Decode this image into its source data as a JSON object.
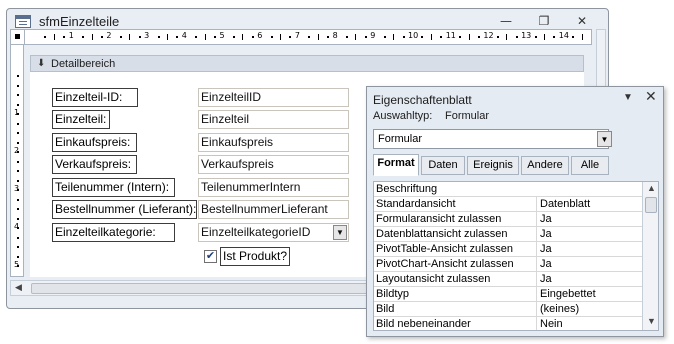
{
  "window": {
    "title": "sfmEinzelteile",
    "minimize_glyph": "—",
    "restore_glyph": "❐",
    "close_glyph": "✕"
  },
  "ruler": {
    "h_numbers": [
      "1",
      "2",
      "3",
      "4",
      "5",
      "6",
      "7",
      "8",
      "9",
      "10",
      "11",
      "12",
      "13",
      "14"
    ],
    "v_numbers": [
      "1",
      "2",
      "3",
      "4",
      "5"
    ]
  },
  "section": {
    "label": "Detailbereich",
    "icon": "collapse-arrow-icon"
  },
  "form": {
    "rows": [
      {
        "label": "Einzelteil-ID:",
        "field": "EinzelteilID"
      },
      {
        "label": "Einzelteil:",
        "field": "Einzelteil"
      },
      {
        "label": "Einkaufspreis:",
        "field": "Einkaufspreis"
      },
      {
        "label": "Verkaufspreis:",
        "field": "Verkaufspreis"
      },
      {
        "label": "Teilenummer (Intern):",
        "field": "TeilenummerIntern"
      },
      {
        "label": "Bestellnummer (Lieferant):",
        "field": "BestellnummerLieferant"
      },
      {
        "label": "Einzelteilkategorie:",
        "field": "EinzelteilkategorieID"
      }
    ],
    "checkbox_label": "Ist Produkt?",
    "checkbox_checked": true
  },
  "property_sheet": {
    "title": "Eigenschaftenblatt",
    "selection_label": "Auswahltyp:",
    "selection_value": "Formular",
    "object_select": "Formular",
    "tabs": [
      "Format",
      "Daten",
      "Ereignis",
      "Andere",
      "Alle"
    ],
    "active_tab": "Format",
    "properties": [
      {
        "name": "Beschriftung",
        "value": ""
      },
      {
        "name": "Standardansicht",
        "value": "Datenblatt"
      },
      {
        "name": "Formularansicht zulassen",
        "value": "Ja"
      },
      {
        "name": "Datenblattansicht zulassen",
        "value": "Ja"
      },
      {
        "name": "PivotTable-Ansicht zulassen",
        "value": "Ja"
      },
      {
        "name": "PivotChart-Ansicht zulassen",
        "value": "Ja"
      },
      {
        "name": "Layoutansicht zulassen",
        "value": "Ja"
      },
      {
        "name": "Bildtyp",
        "value": "Eingebettet"
      },
      {
        "name": "Bild",
        "value": "(keines)"
      },
      {
        "name": "Bild nebeneinander",
        "value": "Nein"
      }
    ]
  },
  "colors": {
    "window_bg": "#e9eef5",
    "section_bar": "#d8dee8",
    "field_border": "#c9c4bc",
    "label_border": "#3c3c3c"
  }
}
